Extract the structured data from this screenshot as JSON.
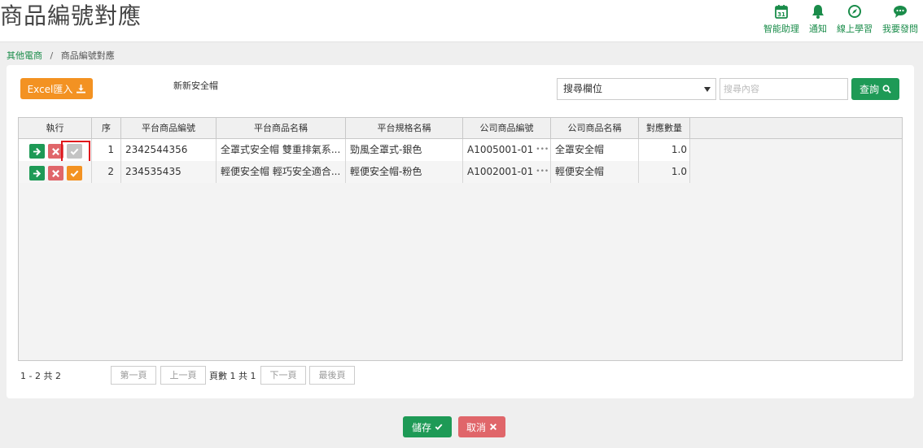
{
  "page": {
    "title": "商品編號對應"
  },
  "top_nav": [
    {
      "label": "智能助理",
      "icon": "calendar-icon"
    },
    {
      "label": "通知",
      "icon": "bell-icon"
    },
    {
      "label": "線上學習",
      "icon": "compass-icon"
    },
    {
      "label": "我要發問",
      "icon": "chat-bubble-icon"
    }
  ],
  "breadcrumb": {
    "parent": "其他電商",
    "separator": "/",
    "current": "商品編號對應"
  },
  "toolbar": {
    "excel_label": "Excel匯入",
    "doc_name": "新新安全帽",
    "field_select_value": "搜尋欄位",
    "search_placeholder": "搜尋內容",
    "query_label": "查詢"
  },
  "table": {
    "columns": [
      "執行",
      "序",
      "平台商品編號",
      "平台商品名稱",
      "平台規格名稱",
      "公司商品編號",
      "公司商品名稱",
      "對應數量"
    ],
    "rows": [
      {
        "seq": "1",
        "platform_id": "2342544356",
        "platform_name": "全罩式安全帽 雙重排氣系...",
        "spec_name": "勁風全罩式-銀色",
        "company_id": "A1005001-01",
        "company_name": "全罩安全帽",
        "qty": "1.0"
      },
      {
        "seq": "2",
        "platform_id": "234535435",
        "platform_name": "輕便安全帽 輕巧安全適合...",
        "spec_name": "輕便安全帽-粉色",
        "company_id": "A1002001-01",
        "company_name": "輕便安全帽",
        "qty": "1.0"
      }
    ],
    "more_glyph": "•••"
  },
  "pager": {
    "info": "1 - 2 共 2",
    "first": "第一頁",
    "prev": "上一頁",
    "page_text": "頁數 1 共 1",
    "next": "下一頁",
    "last": "最後頁"
  },
  "footer": {
    "save_label": "儲存",
    "cancel_label": "取消"
  },
  "colors": {
    "green": "#1e9a56",
    "orange": "#f39222",
    "red": "#e0666a",
    "highlight": "#e0161c"
  }
}
